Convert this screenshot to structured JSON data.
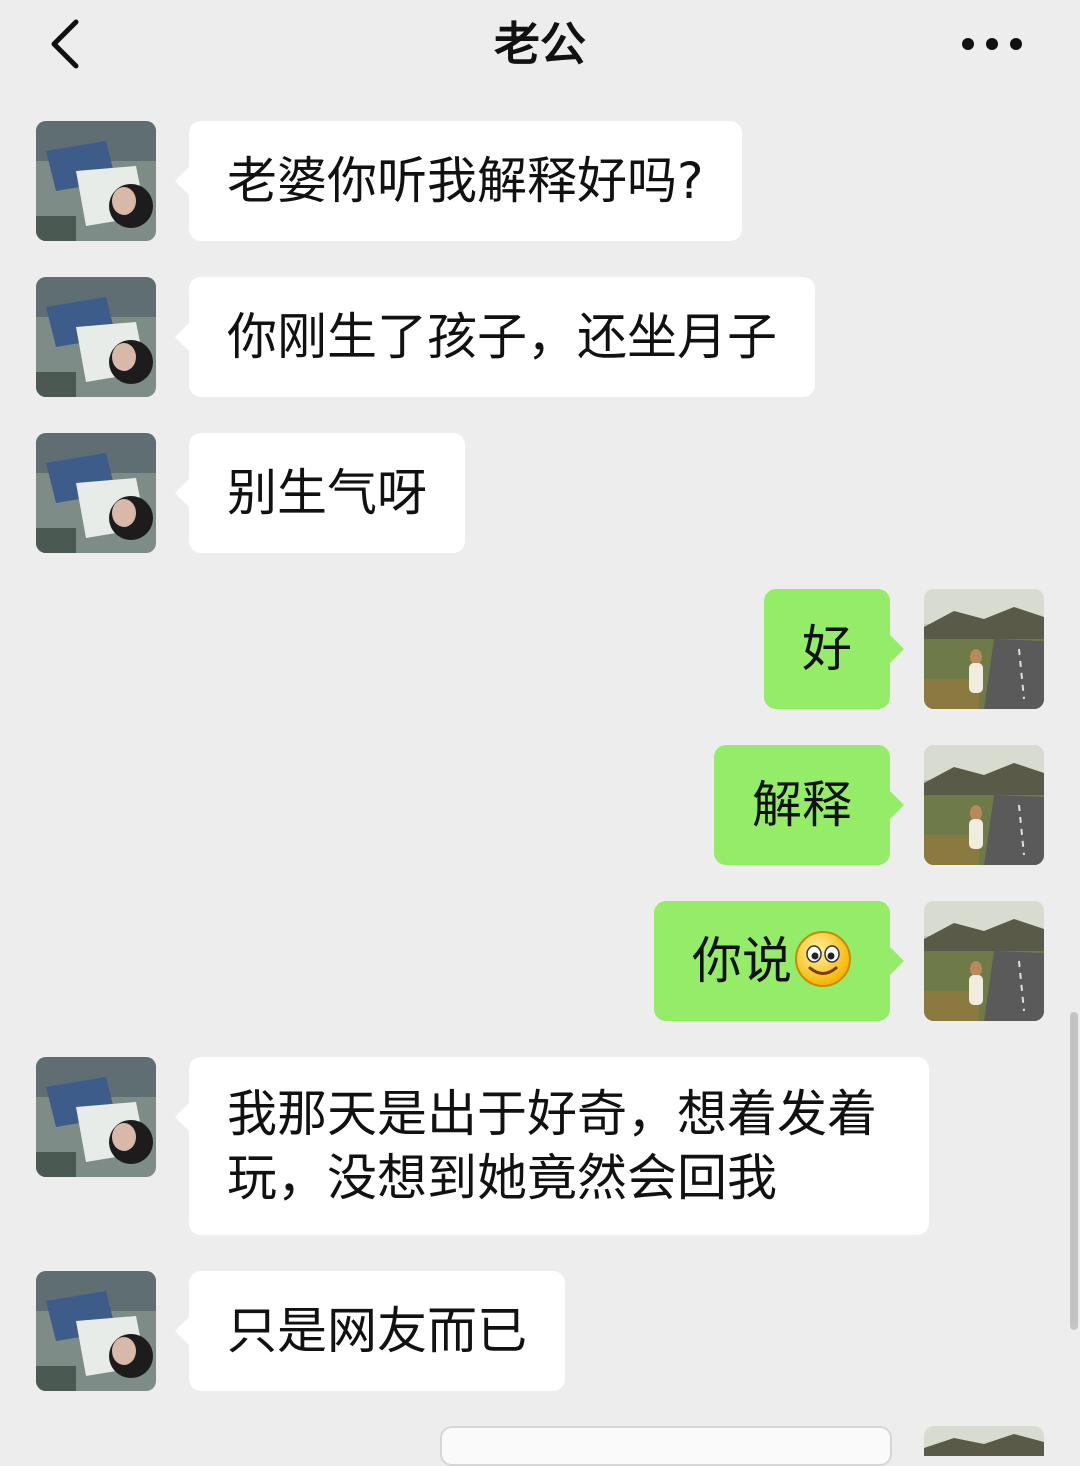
{
  "header": {
    "title": "老公",
    "back_icon": "chevron-left-icon",
    "more_icon": "more-dots-icon"
  },
  "colors": {
    "background": "#ededed",
    "incoming_bubble": "#ffffff",
    "outgoing_bubble": "#95ec69"
  },
  "messages": [
    {
      "side": "in",
      "text": "老婆你听我解释好吗?"
    },
    {
      "side": "in",
      "text": "你刚生了孩子，还坐月子"
    },
    {
      "side": "in",
      "text": "别生气呀"
    },
    {
      "side": "out",
      "text": "好"
    },
    {
      "side": "out",
      "text": "解释"
    },
    {
      "side": "out",
      "text": "你说",
      "emoji": "smiley-emoji-icon"
    },
    {
      "side": "in",
      "text_line1": "我那天是出于好奇，想着发着",
      "text_line2": "玩，没想到她竟然会回我"
    },
    {
      "side": "in",
      "text": "只是网友而已"
    }
  ]
}
